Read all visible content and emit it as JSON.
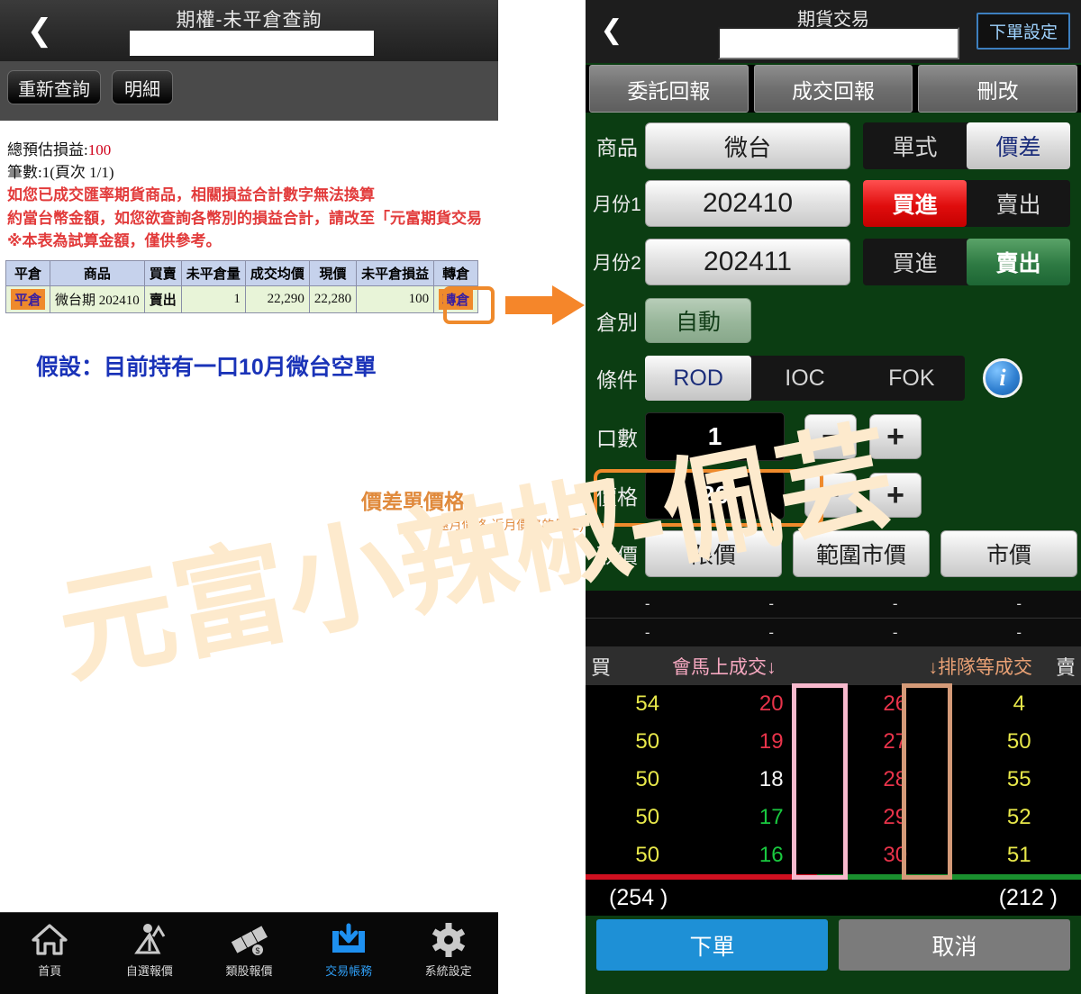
{
  "left_panel": {
    "title": "期權-未平倉查詢",
    "back_icon": "chevron-left",
    "account_value": "",
    "toolbar": {
      "requery": "重新查詢",
      "detail": "明細"
    },
    "summary": {
      "total_pnl_label": "總預估損益:",
      "total_pnl_value": "100",
      "count_line": "筆數:1(頁次 1/1)",
      "warnings": [
        "如您已成交匯率期貨商品，相關損益合計數字無法換算",
        "約當台幣金額，如您欲查詢各幣別的損益合計，請改至「元富期貨交易",
        "※本表為試算金額，僅供參考。"
      ]
    },
    "table": {
      "headers": [
        "平倉",
        "商品",
        "買賣",
        "未平倉量",
        "成交均價",
        "現價",
        "未平倉損益",
        "轉倉"
      ],
      "rows": [
        {
          "close": "平倉",
          "product": "微台期 202410",
          "side": "賣出",
          "open_qty": "1",
          "avg_price": "22,290",
          "current_price": "22,280",
          "pnl": "100",
          "rollover": "轉倉"
        }
      ]
    },
    "assume_note": "假設：目前持有一口10月微台空單",
    "price_note_title": "價差單價格",
    "price_note_sub": "(遠月價格-近月價格的價差)",
    "nav": [
      {
        "label": "首頁",
        "icon": "home-icon",
        "active": false
      },
      {
        "label": "自選報價",
        "icon": "watchlist-icon",
        "active": false
      },
      {
        "label": "類股報價",
        "icon": "sector-quote-icon",
        "active": false
      },
      {
        "label": "交易帳務",
        "icon": "trade-account-icon",
        "active": true
      },
      {
        "label": "系統設定",
        "icon": "gear-icon",
        "active": false
      }
    ]
  },
  "right_panel": {
    "title": "期貨交易",
    "back_icon": "chevron-left",
    "account_value": "",
    "order_settings_btn": "下單設定",
    "tabs": [
      "委託回報",
      "成交回報",
      "刪改"
    ],
    "form": {
      "product_label": "商品",
      "product_value": "微台",
      "order_type": {
        "single": "單式",
        "spread": "價差",
        "selected": "價差"
      },
      "month1_label": "月份1",
      "month1_value": "202410",
      "month1_side": {
        "buy": "買進",
        "sell": "賣出",
        "selected": "買進"
      },
      "month2_label": "月份2",
      "month2_value": "202411",
      "month2_side": {
        "buy": "買進",
        "sell": "賣出",
        "selected": "賣出"
      },
      "position_label": "倉別",
      "position_value": "自動",
      "condition_label": "條件",
      "conditions": [
        "ROD",
        "IOC",
        "FOK"
      ],
      "condition_selected": "ROD",
      "info_icon": "info-icon",
      "qty_label": "口數",
      "qty_value": "1",
      "minus": "−",
      "plus": "+",
      "price_label": "價格",
      "price_value": "20",
      "price_type_label": "取價",
      "price_types": [
        "限價",
        "範圍市價",
        "市價"
      ],
      "price_type_selected": "限價"
    },
    "quote_rows": [
      [
        "-",
        "-",
        "-",
        "-"
      ],
      [
        "-",
        "-",
        "-",
        "-"
      ]
    ],
    "book": {
      "buy_side_label": "買",
      "sell_side_label": "賣",
      "note_pink": "會馬上成交↓",
      "note_orange": "↓排隊等成交",
      "rows": [
        {
          "buy_qty": "54",
          "buy_price": "20",
          "buy_color": "px-red",
          "sell_price": "26",
          "sell_color": "px-red",
          "sell_qty": "4"
        },
        {
          "buy_qty": "50",
          "buy_price": "19",
          "buy_color": "px-red",
          "sell_price": "27",
          "sell_color": "px-red",
          "sell_qty": "50"
        },
        {
          "buy_qty": "50",
          "buy_price": "18",
          "buy_color": "px-white",
          "sell_price": "28",
          "sell_color": "px-red",
          "sell_qty": "55"
        },
        {
          "buy_qty": "50",
          "buy_price": "17",
          "buy_color": "px-green",
          "sell_price": "29",
          "sell_color": "px-red",
          "sell_qty": "52"
        },
        {
          "buy_qty": "50",
          "buy_price": "16",
          "buy_color": "px-green",
          "sell_price": "30",
          "sell_color": "px-red",
          "sell_qty": "51"
        }
      ],
      "buy_total": "(254 )",
      "sell_total": "(212 )"
    },
    "actions": {
      "submit": "下單",
      "cancel": "取消"
    }
  },
  "watermark": "元富小辣椒-佩芸",
  "colors": {
    "panel_green": "#0b3d12",
    "highlight_orange": "#ef8a2c",
    "buy_red": "#e00d0d",
    "sell_green": "#2e7a43",
    "submit_blue": "#1e90d6",
    "accent_blue": "#1a33b8",
    "warn_red": "#e23b3b",
    "note_orange": "#e08a3c",
    "book_pink": "#f7b9cd",
    "book_orange": "#d49a78"
  }
}
